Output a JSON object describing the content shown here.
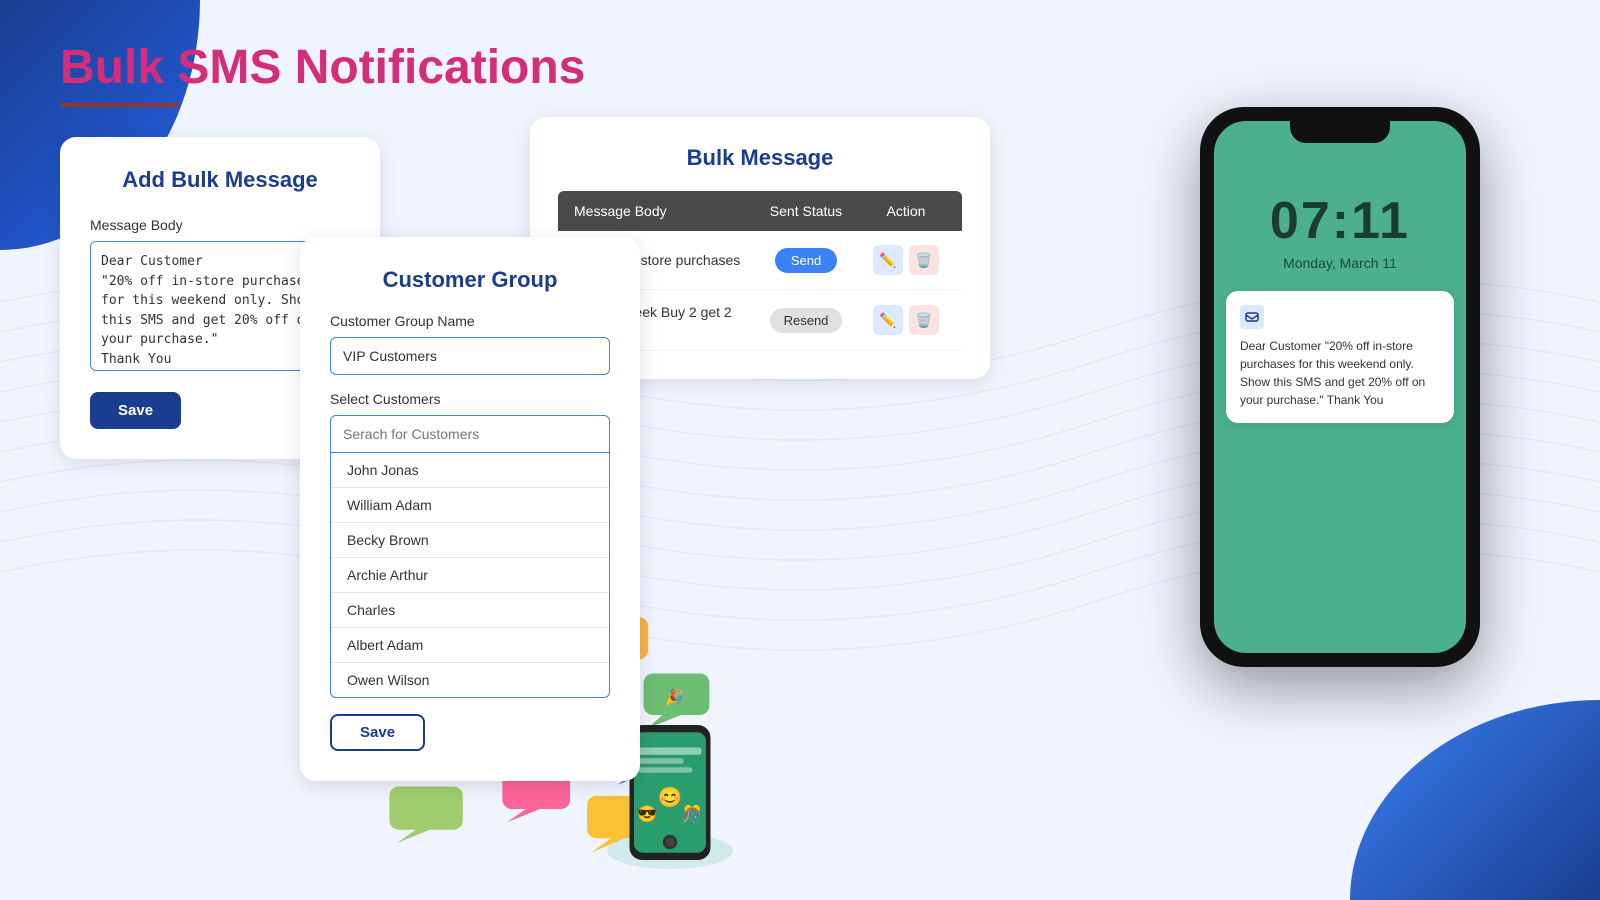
{
  "page": {
    "title": "Bulk SMS Notifications",
    "background_colors": {
      "primary": "#1a3d8f",
      "accent": "#d42e7b",
      "bg": "#f0f4ff"
    }
  },
  "add_bulk_card": {
    "title": "Add Bulk Message",
    "message_label": "Message Body",
    "message_value": "Dear Customer\n\"20% off in-store purchases for this weekend only. Show this SMS and get 20% off on your purchase.\"\nThank You",
    "save_label": "Save"
  },
  "customer_group_card": {
    "title": "Customer Group",
    "group_name_label": "Customer Group Name",
    "group_name_value": "VIP Customers",
    "select_customers_label": "Select Customers",
    "search_placeholder": "Serach for Customers",
    "customers": [
      "John Jonas",
      "William Adam",
      "Becky Brown",
      "Archie Arthur",
      "Charles",
      "Albert Adam",
      "Owen Wilson"
    ],
    "save_label": "Save"
  },
  "bulk_message_card": {
    "title": "Bulk Message",
    "columns": {
      "message_body": "Message Body",
      "sent_status": "Sent Status",
      "action": "Action"
    },
    "rows": [
      {
        "message": "20% off in-store purchases",
        "status": "Send",
        "status_type": "send"
      },
      {
        "message": "Offer of week Buy 2 get 2  50%",
        "status": "Resend",
        "status_type": "resend"
      }
    ]
  },
  "phone": {
    "time": "07:11",
    "date": "Monday, March 11",
    "message": "Dear Customer \"20% off in-store purchases for this weekend only. Show this SMS and get 20% off on your purchase.\" Thank You"
  }
}
